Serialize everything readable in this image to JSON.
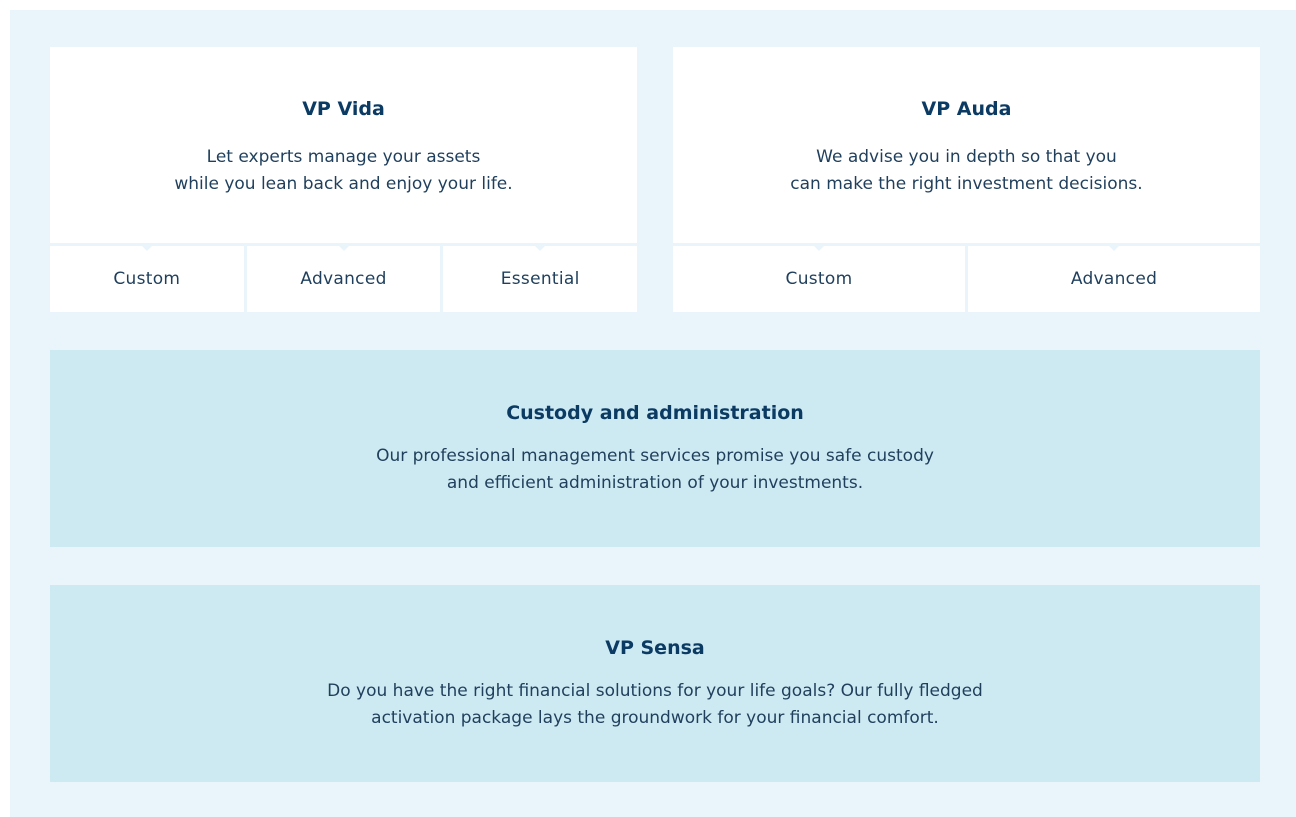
{
  "vida": {
    "title": "VP Vida",
    "desc_line1": "Let experts manage your assets",
    "desc_line2": "while you lean back and enjoy your life.",
    "tabs": [
      "Custom",
      "Advanced",
      "Essential"
    ]
  },
  "auda": {
    "title": "VP Auda",
    "desc_line1": "We advise you in depth so that you",
    "desc_line2": "can make the right investment decisions.",
    "tabs": [
      "Custom",
      "Advanced"
    ]
  },
  "custody": {
    "title": "Custody and administration",
    "desc_line1": "Our professional management services promise you safe custody",
    "desc_line2": "and efficient administration of your investments."
  },
  "sensa": {
    "title": "VP Sensa",
    "desc_line1": "Do you have the right financial solutions for your life goals? Our fully fledged",
    "desc_line2": "activation package lays the groundwork for your financial comfort."
  },
  "colors": {
    "background": "#eaf5fb",
    "card": "#ffffff",
    "panel": "#cde9f2",
    "heading": "#0b3a63",
    "text": "#1f3f5c"
  }
}
